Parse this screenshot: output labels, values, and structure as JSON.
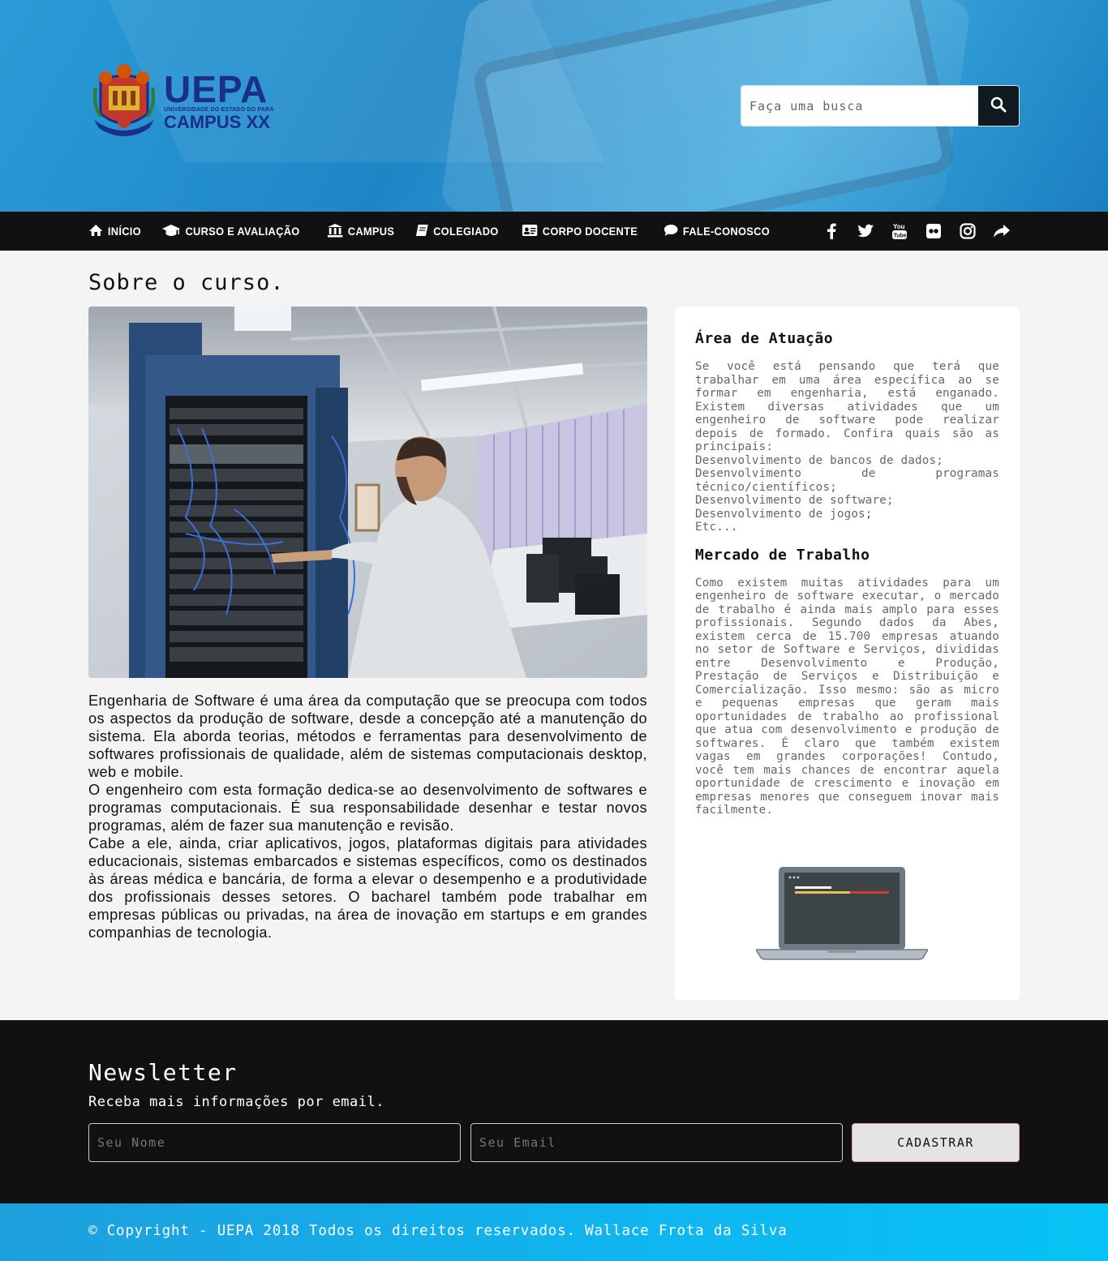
{
  "header": {
    "logo": {
      "title": "UEPA",
      "subtitle": "UNIVERSIDADE DO ESTADO DO PARÁ",
      "campus": "CAMPUS XX"
    },
    "search": {
      "placeholder": "Faça uma busca",
      "icon": "search-icon"
    }
  },
  "nav": {
    "items": [
      {
        "label": "INÍCIO",
        "icon": "home-icon"
      },
      {
        "label": "CURSO E AVALIAÇÃO",
        "icon": "graduation-cap-icon"
      },
      {
        "label": "CAMPUS",
        "icon": "institution-icon"
      },
      {
        "label": "COLEGIADO",
        "icon": "book-icon"
      },
      {
        "label": "CORPO DOCENTE",
        "icon": "id-card-icon"
      },
      {
        "label": "FALE-CONOSCO",
        "icon": "chat-bubble-icon"
      }
    ],
    "social": [
      "facebook-icon",
      "twitter-icon",
      "youtube-icon",
      "flickr-icon",
      "instagram-icon",
      "share-icon"
    ]
  },
  "main": {
    "title": "Sobre o curso.",
    "paragraphs": [
      "Engenharia de Software é uma área da computação que se preocupa com todos os aspectos da produção de software, desde a concepção até a manutenção do sistema. Ela aborda teorias, métodos e ferramentas para desenvolvimento de softwares profissionais de qualidade, além de sistemas computacionais desktop, web e mobile.",
      "O engenheiro com esta formação dedica-se ao desenvolvimento de softwares e programas computacionais. É sua responsabilidade desenhar e testar novos programas, além de fazer sua manutenção e revisão.",
      "Cabe a ele, ainda, criar aplicativos, jogos, plataformas digitais para atividades educacionais, sistemas embarcados e sistemas específicos, como os destinados às áreas médica e bancária, de forma a elevar o desempenho e a produtividade dos profissionais desses setores. O bacharel também pode trabalhar em empresas públicas ou privadas, na área de inovação em startups e em grandes companhias de tecnologia."
    ]
  },
  "aside": {
    "area": {
      "title": "Área de Atuação",
      "intro": "Se você está pensando que terá que trabalhar em uma área específica ao se formar em engenharia, está enganado. Existem diversas atividades que um engenheiro de software pode realizar depois de formado. Confira quais são as principais:",
      "items": [
        "Desenvolvimento de bancos de dados;",
        "Desenvolvimento de programas técnico/científicos;",
        "Desenvolvimento de software;",
        "Desenvolvimento de jogos;",
        "Etc..."
      ]
    },
    "mercado": {
      "title": "Mercado de Trabalho",
      "text": "Como existem muitas atividades para um engenheiro de software executar, o mercado de trabalho é ainda mais amplo para esses profissionais. Segundo dados da Abes, existem cerca de 15.700 empresas atuando no setor de Software e Serviços, divididas entre Desenvolvimento e Produção, Prestação de Serviços e Distribuição e Comercialização. Isso mesmo: são as micro e pequenas empresas que geram mais oportunidades de trabalho ao profissional que atua com desenvolvimento e produção de softwares. É claro que também existem vagas em grandes corporações! Contudo, você tem mais chances de encontrar aquela oportunidade de crescimento e inovação em empresas menores que conseguem inovar mais facilmente."
    }
  },
  "newsletter": {
    "title": "Newsletter",
    "subtitle": "Receba mais informações por email.",
    "name_placeholder": "Seu Nome",
    "email_placeholder": "Seu Email",
    "button": "CADASTRAR"
  },
  "footer": {
    "copyright": "© Copyright - UEPA 2018 Todos os direitos reservados. Wallace Frota da Silva"
  }
}
